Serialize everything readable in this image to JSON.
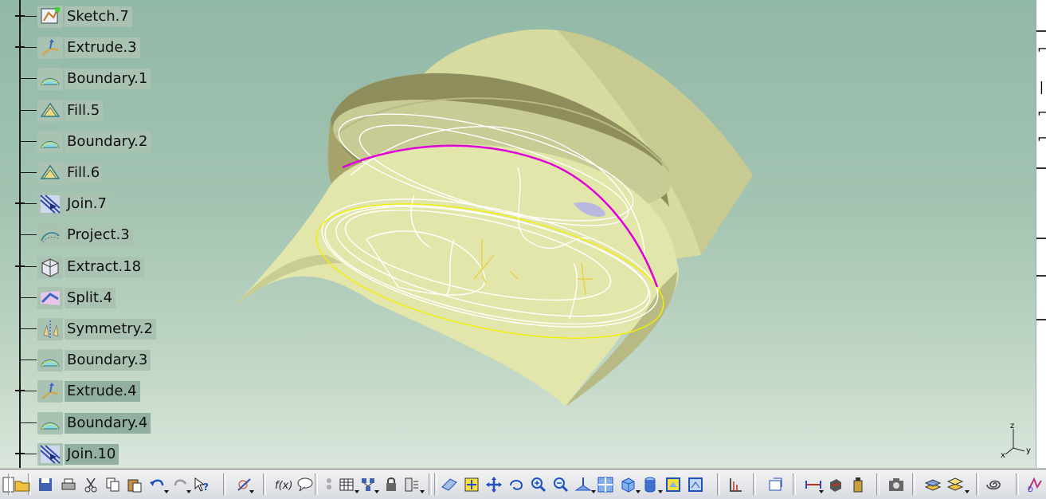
{
  "tree": {
    "items": [
      {
        "label": "Sketch.7",
        "expandable": true,
        "icon": "sketch-icon"
      },
      {
        "label": "Extrude.3",
        "expandable": true,
        "icon": "extrude-icon"
      },
      {
        "label": "Boundary.1",
        "expandable": false,
        "icon": "boundary-icon"
      },
      {
        "label": "Fill.5",
        "expandable": false,
        "icon": "fill-icon"
      },
      {
        "label": "Boundary.2",
        "expandable": false,
        "icon": "boundary-icon"
      },
      {
        "label": "Fill.6",
        "expandable": false,
        "icon": "fill-icon"
      },
      {
        "label": "Join.7",
        "expandable": true,
        "icon": "join-icon"
      },
      {
        "label": "Project.3",
        "expandable": false,
        "icon": "project-icon"
      },
      {
        "label": "Extract.18",
        "expandable": true,
        "icon": "extract-icon"
      },
      {
        "label": "Split.4",
        "expandable": false,
        "icon": "split-icon"
      },
      {
        "label": "Symmetry.2",
        "expandable": false,
        "icon": "symmetry-icon"
      },
      {
        "label": "Boundary.3",
        "expandable": false,
        "icon": "boundary-icon"
      },
      {
        "label": "Extrude.4",
        "expandable": true,
        "icon": "extrude-icon"
      },
      {
        "label": "Boundary.4",
        "expandable": false,
        "icon": "boundary-icon"
      },
      {
        "label": "Join.10",
        "expandable": true,
        "icon": "join-icon"
      }
    ]
  },
  "compass": {
    "x": "x",
    "y": "y",
    "z": "z"
  },
  "toolbar": {
    "buttons": [
      "new-icon",
      "open-icon",
      "save-icon",
      "print-icon",
      "cut-icon",
      "copy-icon",
      "paste-icon",
      "undo-icon",
      "redo-icon",
      "whats-this-icon",
      "sketcher-icon",
      "formula-icon",
      "comment-icon",
      "knowledge-icon",
      "design-table-icon",
      "catalog-icon",
      "lock-icon",
      "parameters-icon",
      "fly-mode-icon",
      "fit-all-icon",
      "pan-icon",
      "rotate-icon",
      "zoom-in-icon",
      "zoom-out-icon",
      "normal-view-icon",
      "multi-view-icon",
      "iso-view-icon",
      "shading-icon",
      "hide-show-icon",
      "swap-space-icon",
      "measure-icon",
      "snapshot-icon",
      "measure-between-icon",
      "measure-item-icon",
      "mass-icon",
      "capture-icon",
      "layer-icon",
      "layer-filter-icon",
      "spiral-icon",
      "catia-logo-icon"
    ]
  }
}
